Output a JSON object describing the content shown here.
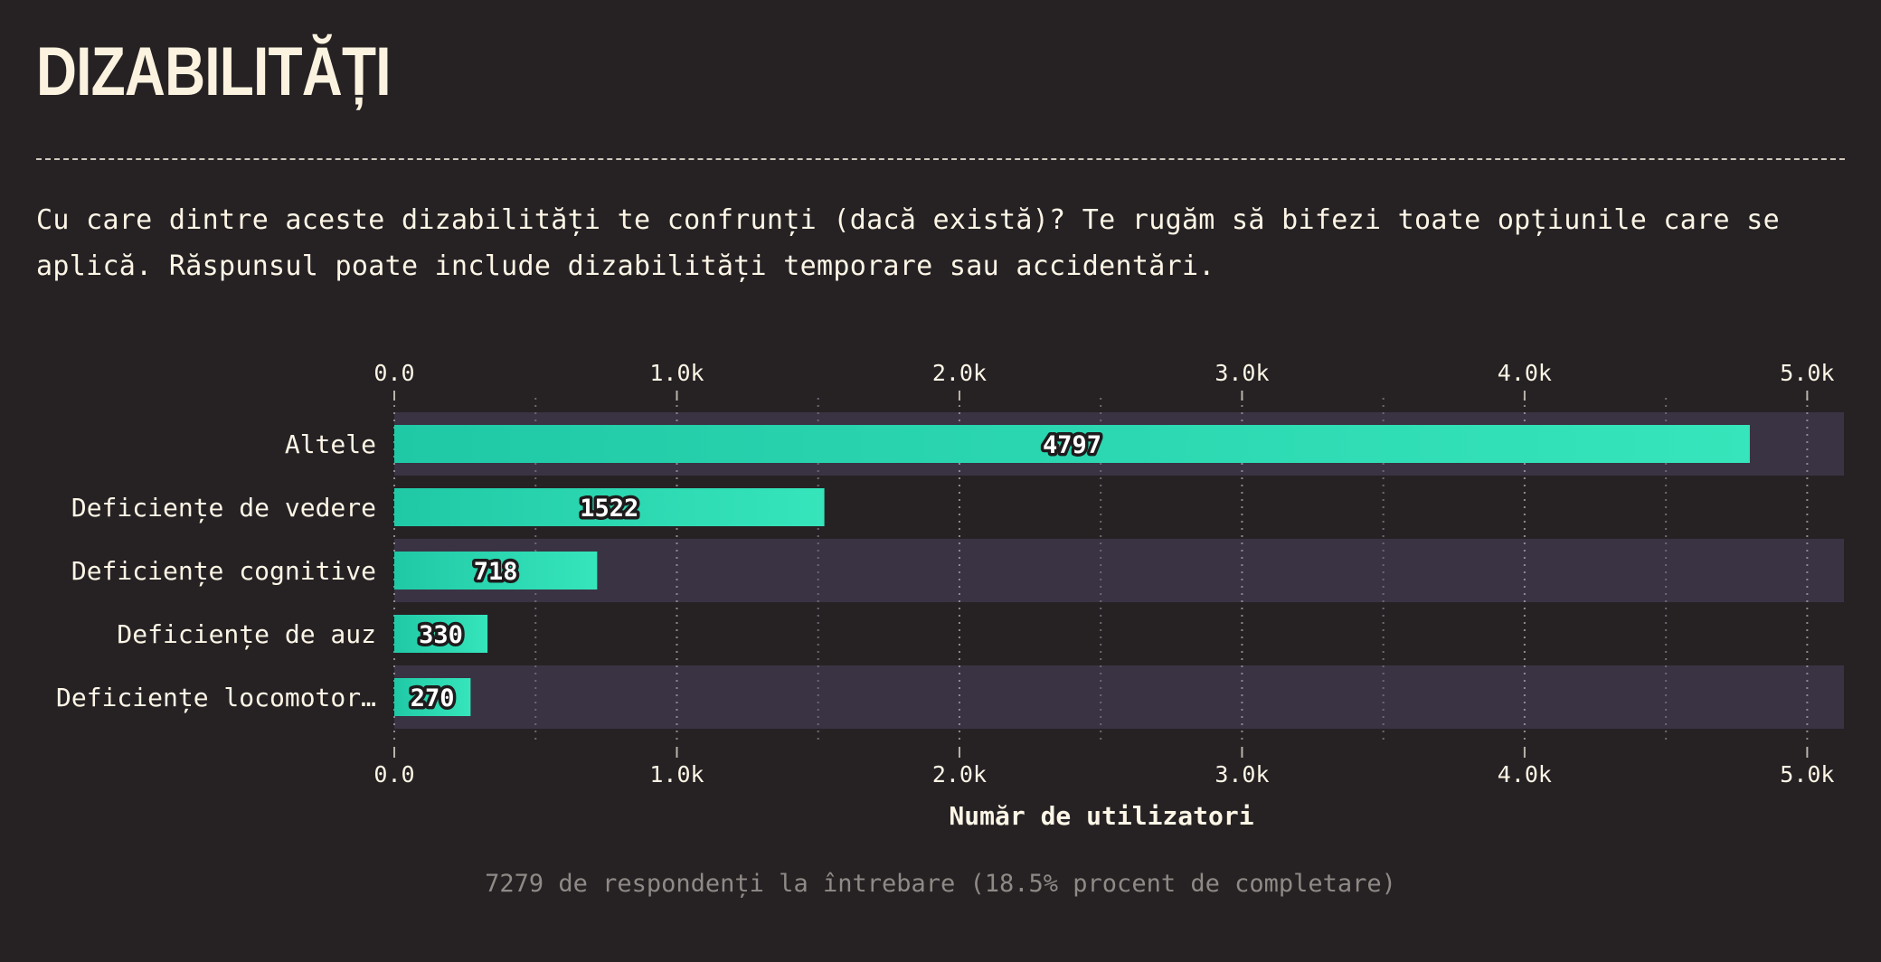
{
  "page": {
    "title": "DIZABILITĂȚI",
    "question": "Cu care dintre aceste dizabilități te confrunți (dacă există)? Te rugăm să bifezi toate opțiunile care se aplică. Răspunsul poate include dizabilități temporare sau accidentări.",
    "footer": "7279 de respondenți la întrebare (18.5% procent de completare)"
  },
  "colors": {
    "background": "#262224",
    "bar_start": "#20c9a6",
    "bar_end": "#36e5bb",
    "row_stripe": "#3a3344",
    "text": "#fdf6e6",
    "muted": "#8f8a86"
  },
  "chart_data": {
    "type": "bar",
    "orientation": "horizontal",
    "categories": [
      "Altele",
      "Deficiențe de vedere",
      "Deficiențe cognitive",
      "Deficiențe de auz",
      "Deficiențe locomotor…"
    ],
    "values": [
      4797,
      1522,
      718,
      330,
      270
    ],
    "xlabel": "Număr de utilizatori",
    "xlim": [
      0,
      5130
    ],
    "ticks": [
      0,
      1000,
      2000,
      3000,
      4000,
      5000
    ],
    "tick_labels": [
      "0.0",
      "1.0k",
      "2.0k",
      "3.0k",
      "4.0k",
      "5.0k"
    ],
    "axis_position": "top-and-bottom",
    "grid": true
  }
}
